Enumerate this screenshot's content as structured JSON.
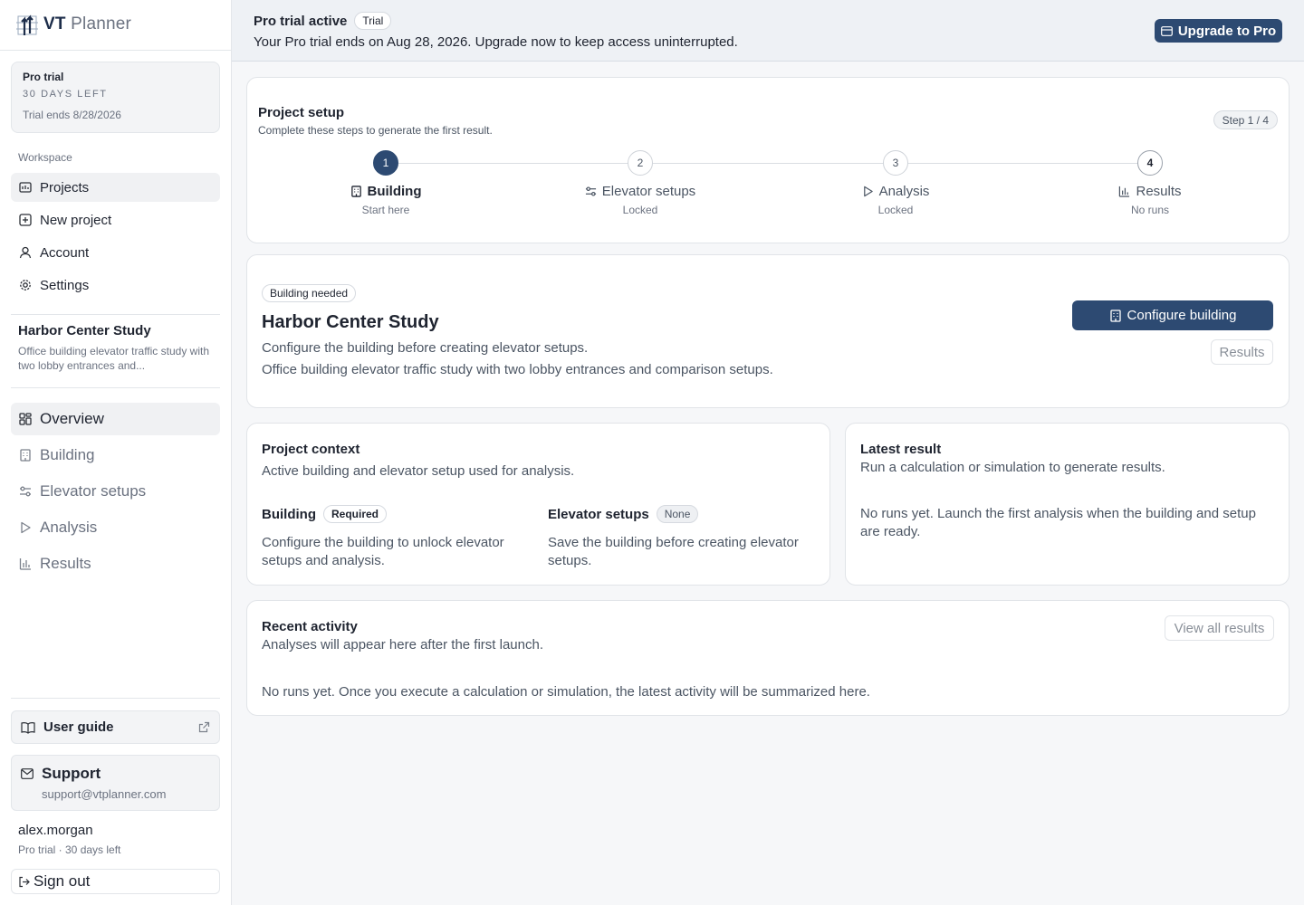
{
  "brand": {
    "strong": "VT",
    "light": "Planner"
  },
  "trial_card": {
    "title": "Pro trial",
    "days": "30 DAYS LEFT",
    "ends": "Trial ends 8/28/2026"
  },
  "workspace": {
    "label": "Workspace",
    "items": [
      {
        "label": "Projects",
        "icon": "folder-icon"
      },
      {
        "label": "New project",
        "icon": "plus-square-icon"
      },
      {
        "label": "Account",
        "icon": "user-icon"
      },
      {
        "label": "Settings",
        "icon": "gear-icon"
      }
    ]
  },
  "current_project": {
    "name": "Harbor Center Study",
    "desc": "Office building elevator traffic study with two lobby entrances and..."
  },
  "project_nav": [
    {
      "label": "Overview",
      "icon": "grid-icon"
    },
    {
      "label": "Building",
      "icon": "building-icon"
    },
    {
      "label": "Elevator setups",
      "icon": "sliders-icon"
    },
    {
      "label": "Analysis",
      "icon": "play-icon"
    },
    {
      "label": "Results",
      "icon": "bar-chart-icon"
    }
  ],
  "guide": {
    "label": "User guide"
  },
  "support": {
    "label": "Support",
    "email": "support@vtplanner.com"
  },
  "user": {
    "name": "alex.morgan",
    "sub": "Pro trial · 30 days left",
    "signout": "Sign out"
  },
  "banner": {
    "title": "Pro trial active",
    "badge": "Trial",
    "message": "Your Pro trial ends on Aug 28, 2026. Upgrade now to keep access uninterrupted.",
    "upgrade": "Upgrade to Pro"
  },
  "setup": {
    "title": "Project setup",
    "subtitle": "Complete these steps to generate the first result.",
    "step_badge": "Step 1 / 4",
    "steps": [
      {
        "num": "1",
        "label": "Building",
        "status": "Start here"
      },
      {
        "num": "2",
        "label": "Elevator setups",
        "status": "Locked"
      },
      {
        "num": "3",
        "label": "Analysis",
        "status": "Locked"
      },
      {
        "num": "4",
        "label": "Results",
        "status": "No runs"
      }
    ]
  },
  "hero": {
    "badge": "Building needed",
    "title": "Harbor Center Study",
    "line1": "Configure the building before creating elevator setups.",
    "line2": "Office building elevator traffic study with two lobby entrances and comparison setups.",
    "configure": "Configure building",
    "results": "Results"
  },
  "context": {
    "title": "Project context",
    "subtitle": "Active building and elevator setup used for analysis.",
    "building_label": "Building",
    "building_badge": "Required",
    "building_desc": "Configure the building to unlock elevator setups and analysis.",
    "setups_label": "Elevator setups",
    "setups_badge": "None",
    "setups_desc": "Save the building before creating elevator setups."
  },
  "latest": {
    "title": "Latest result",
    "subtitle": "Run a calculation or simulation to generate results.",
    "empty": "No runs yet. Launch the first analysis when the building and setup are ready."
  },
  "activity": {
    "title": "Recent activity",
    "subtitle": "Analyses will appear here after the first launch.",
    "view_all": "View all results",
    "empty": "No runs yet. Once you execute a calculation or simulation, the latest activity will be summarized here."
  },
  "colors": {
    "primary": "#2d4a72",
    "sidebar_bg": "#ffffff",
    "banner_bg": "#eef1f5"
  }
}
